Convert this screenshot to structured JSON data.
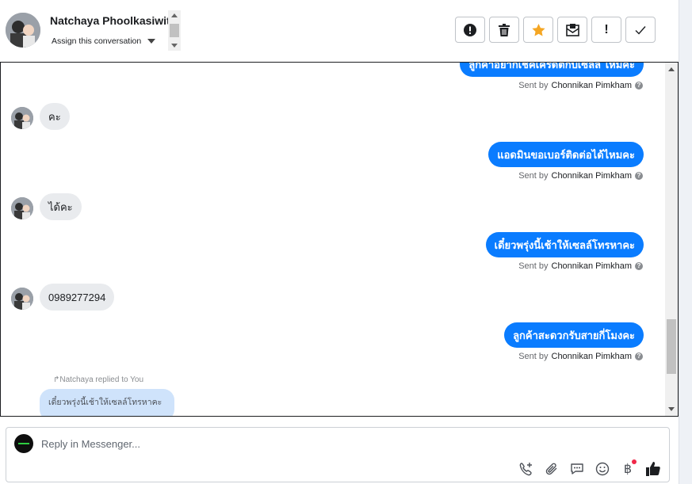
{
  "header": {
    "contact_name": "Natchaya Phoolkasiwit",
    "assign_label": "Assign this conversation",
    "actions": [
      {
        "name": "spam-button",
        "icon": "alert-circle-icon"
      },
      {
        "name": "delete-button",
        "icon": "trash-icon"
      },
      {
        "name": "star-button",
        "icon": "star-icon",
        "color": "#f5a623"
      },
      {
        "name": "mark-unread-button",
        "icon": "envelope-icon"
      },
      {
        "name": "important-button",
        "icon": "exclamation-icon",
        "label": "!"
      },
      {
        "name": "done-button",
        "icon": "check-icon"
      }
    ]
  },
  "messages": {
    "out_0": {
      "text": "ลูกค้าอยากเช็คเครดิตกับเซลล์ ไหมคะ",
      "sent_by_prefix": "Sent by",
      "sender": "Chonnikan Pimkham"
    },
    "in_1": {
      "text": "คะ"
    },
    "out_2": {
      "text": "แอดมินขอเบอร์ติดต่อได้ไหมคะ",
      "sent_by_prefix": "Sent by",
      "sender": "Chonnikan Pimkham"
    },
    "in_3": {
      "text": "ได้คะ"
    },
    "out_4": {
      "text": "เดี๋ยวพรุ่งนี้เช้าให้เซลล์โทรหาคะ",
      "sent_by_prefix": "Sent by",
      "sender": "Chonnikan Pimkham"
    },
    "in_5": {
      "text": "0989277294"
    },
    "out_6": {
      "text": "ลูกค้าสะดวกรับสายกี่โมงคะ",
      "sent_by_prefix": "Sent by",
      "sender": "Chonnikan Pimkham"
    },
    "reply": {
      "replied_label": "Natchaya replied to You",
      "quoted_text": "เดี๋ยวพรุ่งนี้เช้าให้เซลล์โทรหาคะ"
    }
  },
  "composer": {
    "placeholder": "Reply in Messenger...",
    "icons": [
      "add-call-icon",
      "attachment-icon",
      "saved-replies-icon",
      "emoji-icon",
      "payment-icon",
      "like-icon"
    ],
    "payment_symbol": "฿"
  },
  "colors": {
    "outgoing_bubble": "#0a7cff",
    "incoming_bubble": "#e9ebee",
    "quote_bubble": "#cfe3fb",
    "star": "#f5a623",
    "notification_dot": "#f02849"
  }
}
